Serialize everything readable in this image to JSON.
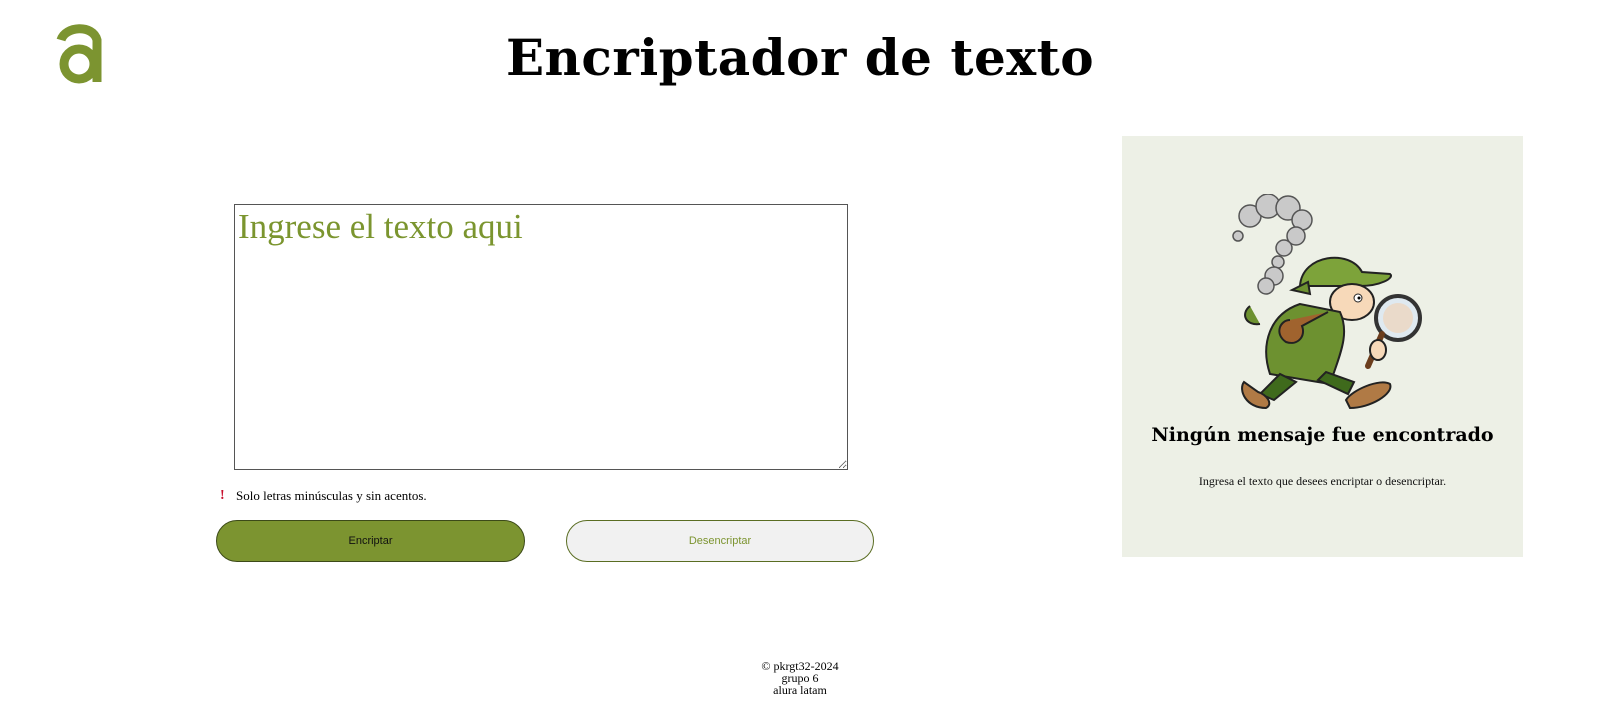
{
  "header": {
    "title": "Encriptador de texto",
    "logo_icon": "alura-logo-icon"
  },
  "input": {
    "placeholder": "Ingrese el texto aqui",
    "value": ""
  },
  "hint": {
    "icon": "exclamation-icon",
    "text": "Solo letras minúsculas y sin acentos."
  },
  "buttons": {
    "encrypt_label": "Encriptar",
    "decrypt_label": "Desencriptar"
  },
  "result": {
    "image_icon": "detective-icon",
    "title": "Ningún mensaje fue encontrado",
    "description": "Ingresa el texto que desees encriptar o desencriptar."
  },
  "footer": {
    "line1": "© pkrgt32-2024",
    "line2": "grupo 6",
    "line3": "alura latam"
  },
  "colors": {
    "accent": "#7c9430",
    "panel_bg": "#edf0e6",
    "placeholder": "#7b952f"
  }
}
